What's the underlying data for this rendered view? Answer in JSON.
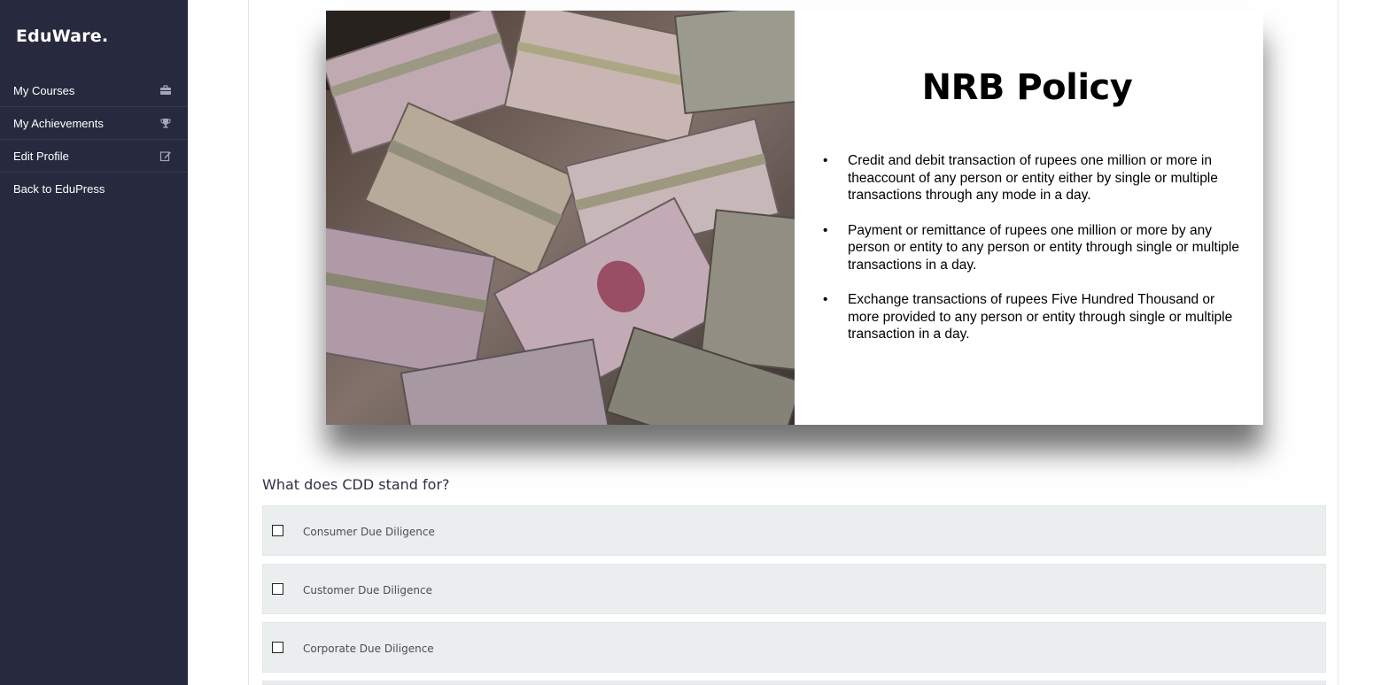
{
  "sidebar": {
    "brand": "EduWare.",
    "items": [
      {
        "label": "My Courses",
        "icon": "briefcase-icon"
      },
      {
        "label": "My Achievements",
        "icon": "trophy-icon"
      },
      {
        "label": "Edit Profile",
        "icon": "edit-icon"
      },
      {
        "label": "Back to EduPress",
        "icon": ""
      }
    ]
  },
  "slide": {
    "title": "NRB Policy",
    "bullets": [
      "Credit and debit transaction of rupees one million or more in theaccount of any person or entity either by single or multiple transactions through any mode in a day.",
      "Payment or remittance of rupees one million or more by any person or entity to any person or entity through single or multiple transactions in a day.",
      "Exchange transactions of rupees Five Hundred Thousand or more provided to any person or entity through single or multiple transaction in a day."
    ]
  },
  "quiz": {
    "question": "What does CDD stand for?",
    "options": [
      {
        "label": "Consumer Due Diligence",
        "checked": false
      },
      {
        "label": "Customer Due Diligence",
        "checked": false
      },
      {
        "label": "Corporate Due Diligence",
        "checked": false
      }
    ]
  },
  "colors": {
    "sidebar_bg": "#272a3f",
    "option_bg": "#ebeeef"
  }
}
